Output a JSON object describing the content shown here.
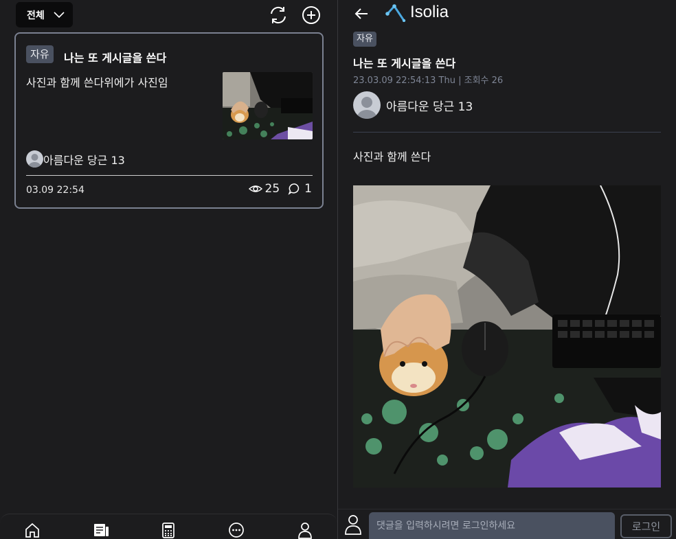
{
  "list": {
    "filter_label": "전체",
    "post": {
      "category": "자유",
      "title": "나는 또 게시글을 쓴다",
      "excerpt": "사진과 함께 쓴다위에가 사진임",
      "author": "아름다운 당근 13",
      "date": "03.09 22:54",
      "views": "25",
      "comments": "1"
    }
  },
  "bottom_nav": {
    "items": [
      {
        "icon": "home-icon"
      },
      {
        "icon": "board-icon"
      },
      {
        "icon": "calculator-icon"
      },
      {
        "icon": "more-icon"
      },
      {
        "icon": "profile-icon"
      }
    ]
  },
  "detail": {
    "app_name": "Isolia",
    "category": "자유",
    "title": "나는 또 게시글을 쓴다",
    "meta": "23.03.09 22:54:13 Thu | 조회수 26",
    "author": "아름다운 당근 13",
    "body": "사진과 함께 쓴다"
  },
  "comment": {
    "placeholder": "댓글을 입력하시려면 로그인하세요",
    "login_label": "로그인"
  },
  "colors": {
    "background": "#1c1c1e",
    "tag_bg": "#4a5160",
    "card_border": "#7b8191",
    "meta_text": "#7e8595",
    "logo_accent": "#4aa8e0"
  }
}
